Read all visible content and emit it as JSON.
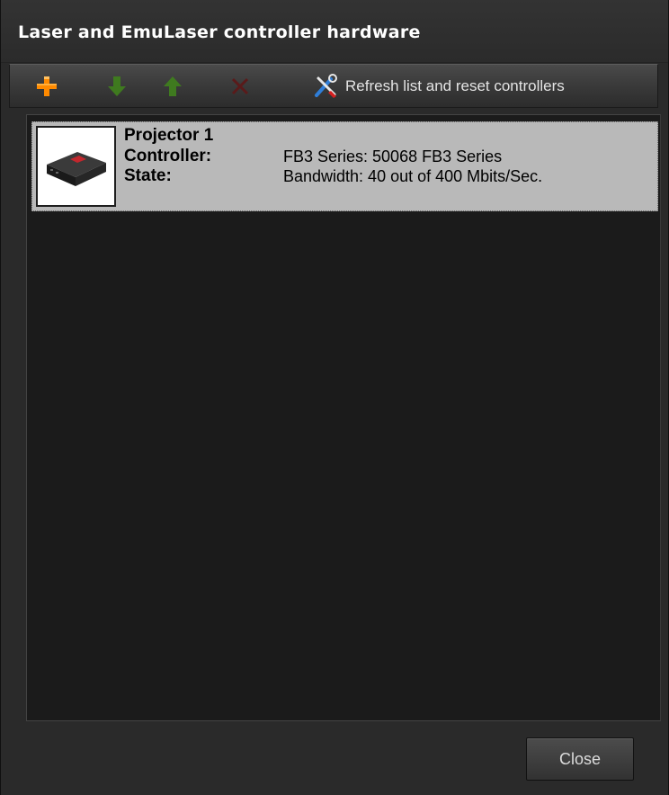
{
  "window": {
    "title": "Laser and EmuLaser controller hardware"
  },
  "toolbar": {
    "buttons": [
      {
        "icon": "plus-icon",
        "color": "#ff8a00",
        "enabled": true
      },
      {
        "icon": "arrow-down-icon",
        "color": "#3f7a1f",
        "enabled": false
      },
      {
        "icon": "arrow-up-icon",
        "color": "#3f7a1f",
        "enabled": false
      },
      {
        "icon": "delete-x-icon",
        "color": "#5a1a1a",
        "enabled": false
      }
    ],
    "refresh_label": "Refresh list and reset controllers",
    "refresh_icon": "wrench-screwdriver-icon"
  },
  "list": {
    "items": [
      {
        "name": "Projector 1",
        "controller_label": "Controller:",
        "controller_value": "FB3 Series: 50068 FB3 Series",
        "state_label": "State:",
        "state_value": "Bandwidth: 40 out of 400 Mbits/Sec.",
        "icon": "fb3-device-icon"
      }
    ]
  },
  "footer": {
    "close_label": "Close"
  },
  "colors": {
    "background": "#2a2a2a",
    "list_background": "#1b1b1b",
    "selected_item": "#b9b9b9"
  }
}
